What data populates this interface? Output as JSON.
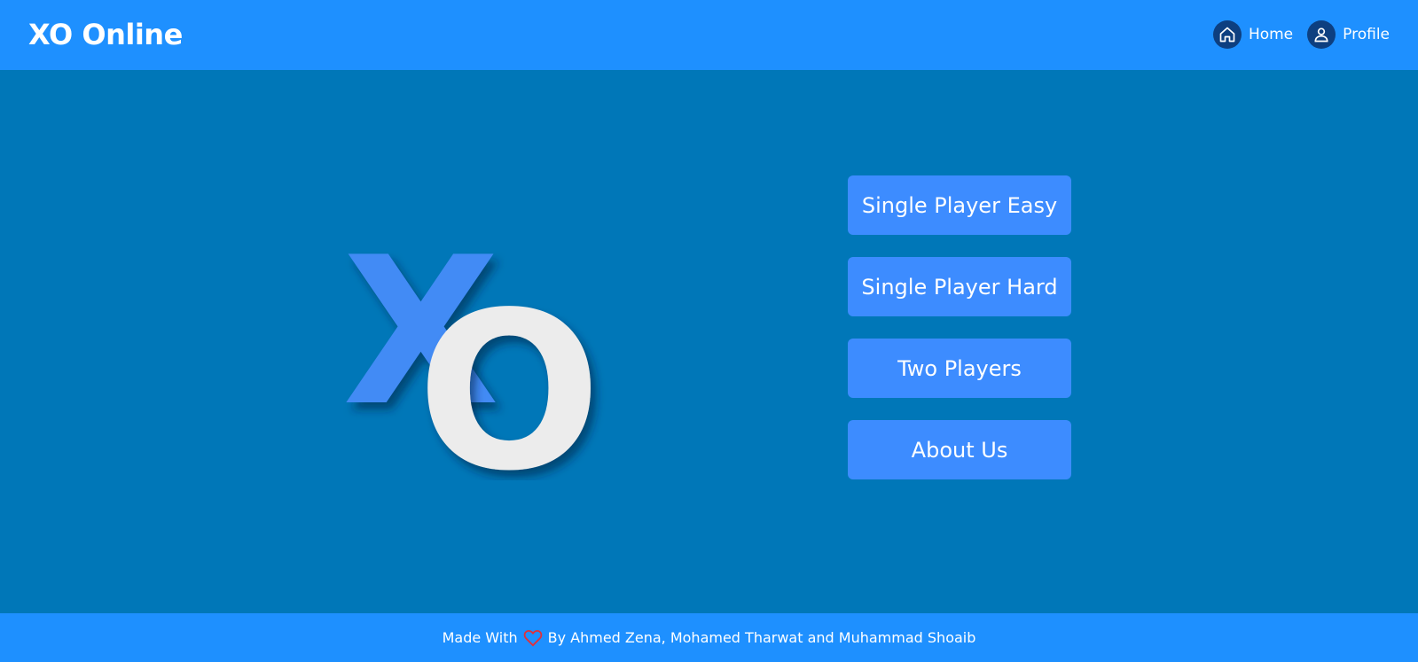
{
  "header": {
    "brand": "XO Online",
    "nav": [
      {
        "label": "Home",
        "icon": "home-icon"
      },
      {
        "label": "Profile",
        "icon": "user-icon"
      }
    ]
  },
  "logo": {
    "letters": [
      "X",
      "O"
    ],
    "x_color": "#428bf5",
    "o_color": "#ececec"
  },
  "menu": {
    "items": [
      {
        "label": "Single Player Easy"
      },
      {
        "label": "Single Player Hard"
      },
      {
        "label": "Two Players"
      },
      {
        "label": "About Us"
      }
    ]
  },
  "footer": {
    "prefix": "Made With",
    "heart_icon": "heart-icon",
    "suffix": "By Ahmed Zena, Mohamed Tharwat and Muhammad Shoaib"
  },
  "colors": {
    "header_bg": "#1e90ff",
    "main_bg": "#0077b8",
    "button_bg": "#3d8cff",
    "heart": "#e0303a"
  }
}
